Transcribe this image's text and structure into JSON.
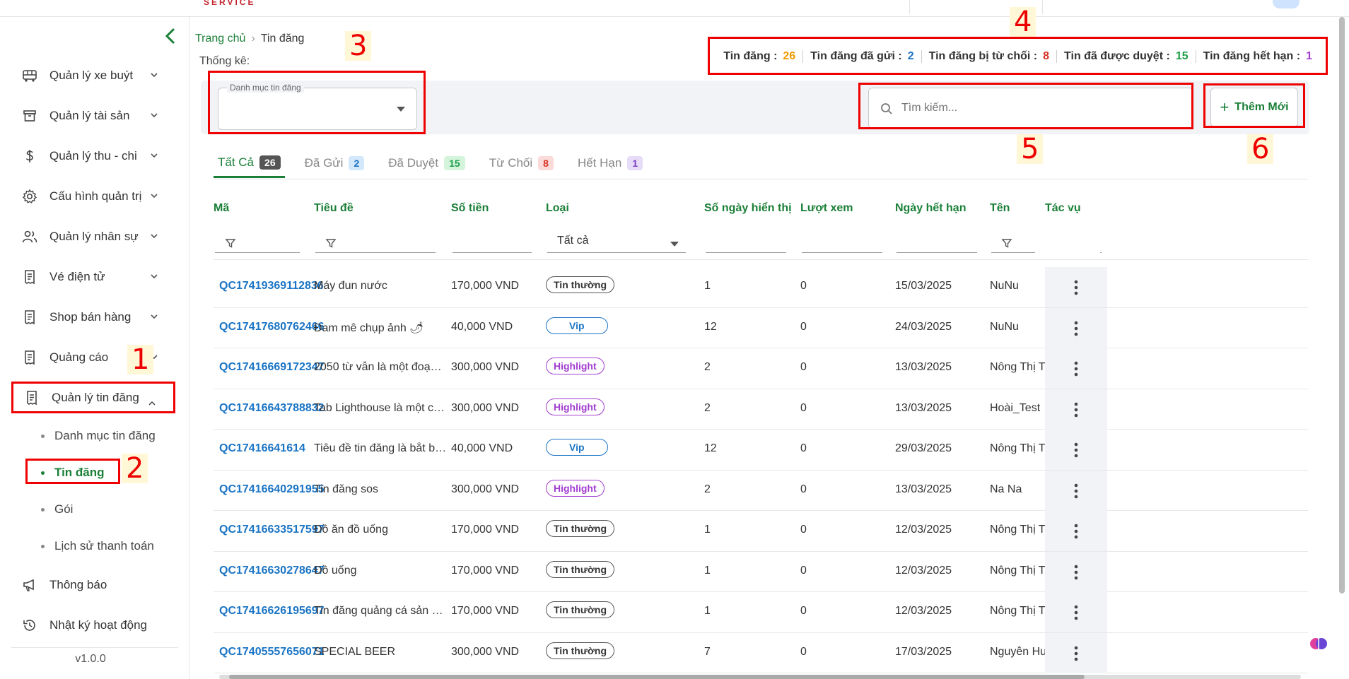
{
  "topbar": {
    "brand": "SERVICE"
  },
  "sidebar": {
    "items": [
      {
        "label": "Quản lý xe buýt",
        "icon": "bus-icon"
      },
      {
        "label": "Quản lý tài sản",
        "icon": "archive-icon"
      },
      {
        "label": "Quản lý thu - chi",
        "icon": "dollar-icon"
      },
      {
        "label": "Cấu hình quản trị",
        "icon": "gear-icon"
      },
      {
        "label": "Quản lý nhân sự",
        "icon": "users-icon"
      },
      {
        "label": "Vé điện tử",
        "icon": "receipt-icon"
      },
      {
        "label": "Shop bán hàng",
        "icon": "receipt-icon"
      },
      {
        "label": "Quảng cáo",
        "icon": "receipt-icon"
      },
      {
        "label": "Quản lý tin đăng",
        "icon": "receipt-icon"
      }
    ],
    "subitems": [
      "Danh mục tin đăng",
      "Tin đăng",
      "Gói",
      "Lịch sử thanh toán"
    ],
    "after": [
      {
        "label": "Thông báo",
        "icon": "megaphone-icon"
      },
      {
        "label": "Nhật ký hoạt động",
        "icon": "history-icon"
      }
    ],
    "version": "v1.0.0"
  },
  "annotations": {
    "n1": "1",
    "n2": "2",
    "n3": "3",
    "n4": "4",
    "n5": "5",
    "n6": "6"
  },
  "breadcrumb": {
    "home": "Trang chủ",
    "current": "Tin đăng"
  },
  "stats": {
    "label": "Thống kê:",
    "items": [
      {
        "label": "Tin đăng :",
        "value": "26",
        "color": "#f29900"
      },
      {
        "label": "Tin đăng đã gửi :",
        "value": "2",
        "color": "#1a74c4"
      },
      {
        "label": "Tin đăng bị từ chối :",
        "value": "8",
        "color": "#d93025"
      },
      {
        "label": "Tin đã được duyệt :",
        "value": "15",
        "color": "#1e9e4a"
      },
      {
        "label": "Tin đăng hết hạn :",
        "value": "1",
        "color": "#a13cd0"
      }
    ]
  },
  "filters": {
    "category_label": "Danh mục tin đăng",
    "search_placeholder": "Tìm kiếm...",
    "add_label": "Thêm Mới"
  },
  "tabs": [
    {
      "label": "Tất Cả",
      "count": "26",
      "bg": "#555555",
      "fg": "#ffffff"
    },
    {
      "label": "Đã Gửi",
      "count": "2",
      "bg": "#d4e8fb",
      "fg": "#1a74c4"
    },
    {
      "label": "Đã Duyệt",
      "count": "15",
      "bg": "#d4f5dc",
      "fg": "#1e9e4a"
    },
    {
      "label": "Từ Chối",
      "count": "8",
      "bg": "#fbdada",
      "fg": "#d93025"
    },
    {
      "label": "Hết Hạn",
      "count": "1",
      "bg": "#e6dcf7",
      "fg": "#7b3fc4"
    }
  ],
  "table": {
    "headers": [
      "Mã",
      "Tiêu đề",
      "Số tiền",
      "Loại",
      "Số ngày hiển thị",
      "Lượt xem",
      "Ngày hết hạn",
      "Tên",
      "Tác vụ"
    ],
    "type_filter": "Tất cả",
    "rows": [
      {
        "code": "QC17419369112836",
        "title": "Máy đun nước",
        "amount": "170,000 VND",
        "type": "Tin thường",
        "kind": "n",
        "days": "1",
        "views": "0",
        "expire": "15/03/2025",
        "name": "NuNu"
      },
      {
        "code": "QC17417680762466",
        "title": "Đam mê chụp ảnh 🌶",
        "amount": "40,000 VND",
        "type": "Vip",
        "kind": "v",
        "days": "12",
        "views": "0",
        "expire": "24/03/2025",
        "name": "NuNu"
      },
      {
        "code": "QC17416669172347",
        "title": "2050 từ vẫn là một đoạn kh...",
        "amount": "300,000 VND",
        "type": "Highlight",
        "kind": "h",
        "days": "2",
        "views": "0",
        "expire": "13/03/2025",
        "name": "Nông Thị T"
      },
      {
        "code": "QC17416643788832",
        "title": "Tab Lighthouse là một công...",
        "amount": "300,000 VND",
        "type": "Highlight",
        "kind": "h",
        "days": "2",
        "views": "0",
        "expire": "13/03/2025",
        "name": "Hoài_Test"
      },
      {
        "code": "QC17416641614",
        "title": "Tiêu đề tin đăng là bắt buộ...",
        "amount": "40,000 VND",
        "type": "Vip",
        "kind": "v",
        "days": "12",
        "views": "0",
        "expire": "29/03/2025",
        "name": "Nông Thị T"
      },
      {
        "code": "QC17416640291955",
        "title": "Tin đăng sos",
        "amount": "300,000 VND",
        "type": "Highlight",
        "kind": "h",
        "days": "2",
        "views": "0",
        "expire": "13/03/2025",
        "name": "Na Na"
      },
      {
        "code": "QC17416633517597",
        "title": "Đồ ăn đồ uống",
        "amount": "170,000 VND",
        "type": "Tin thường",
        "kind": "n",
        "days": "1",
        "views": "0",
        "expire": "12/03/2025",
        "name": "Nông Thị T"
      },
      {
        "code": "QC17416630278647",
        "title": "Đồ uống",
        "amount": "170,000 VND",
        "type": "Tin thường",
        "kind": "n",
        "days": "1",
        "views": "0",
        "expire": "12/03/2025",
        "name": "Nông Thị T"
      },
      {
        "code": "QC17416626195697",
        "title": "Tin đăng quảng cá sản phẩ...",
        "amount": "170,000 VND",
        "type": "Tin thường",
        "kind": "n",
        "days": "1",
        "views": "0",
        "expire": "12/03/2025",
        "name": "Nông Thị T"
      },
      {
        "code": "QC17405557656071",
        "title": "SPECIAL BEER",
        "amount": "300,000 VND",
        "type": "Tin thường",
        "kind": "n",
        "days": "7",
        "views": "0",
        "expire": "17/03/2025",
        "name": "Nguyễn Hu"
      }
    ]
  }
}
